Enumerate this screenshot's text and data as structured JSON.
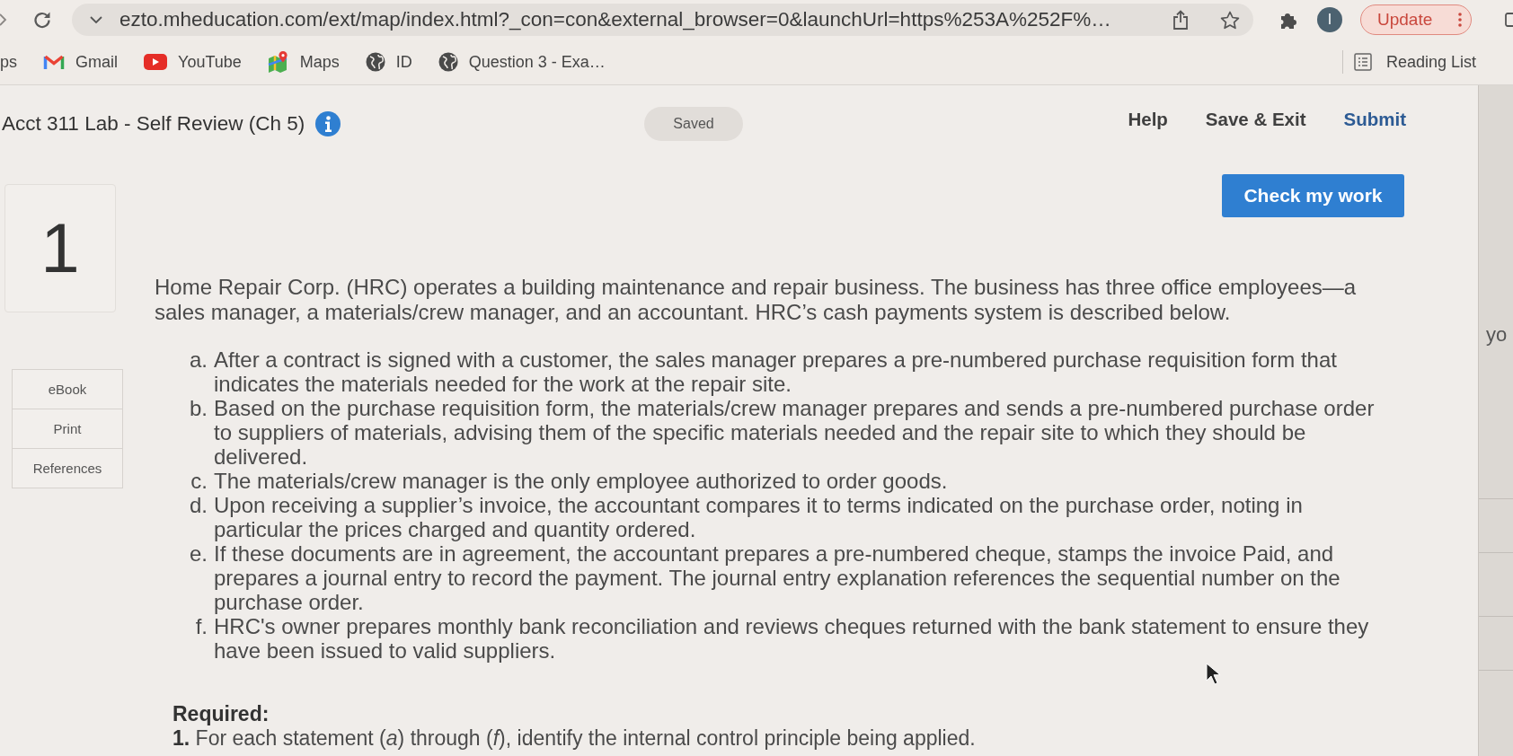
{
  "browser": {
    "address": "ezto.mheducation.com/ext/map/index.html?_con=con&external_browser=0&launchUrl=https%253A%252F%…",
    "profile_initial": "I",
    "update_button": "Update",
    "bookmarks": [
      {
        "label": "ps",
        "kind": "plain"
      },
      {
        "label": "Gmail",
        "kind": "mail"
      },
      {
        "label": "YouTube",
        "kind": "video"
      },
      {
        "label": "Maps",
        "kind": "map"
      },
      {
        "label": "ID",
        "kind": "globe"
      },
      {
        "label": "Question 3 - Exa…",
        "kind": "globe"
      }
    ],
    "reading_list": "Reading List"
  },
  "header": {
    "title": "Acct 311 Lab - Self Review (Ch 5)",
    "save_status": "Saved",
    "links": [
      {
        "label": "Help",
        "kind": "plain"
      },
      {
        "label": "Save & Exit",
        "kind": "plain"
      },
      {
        "label": "Submit",
        "kind": "accent"
      }
    ]
  },
  "check_button": "Check my work",
  "question": {
    "number": "1",
    "tools": [
      "eBook",
      "Print",
      "References"
    ],
    "intro": "Home Repair Corp. (HRC) operates a building maintenance and repair business. The business has three office employees—a sales manager, a materials/crew manager, and an accountant. HRC’s cash payments system is described below.",
    "statements": [
      {
        "letter": "a.",
        "text": "After a contract is signed with a customer, the sales manager prepares a pre-numbered purchase requisition form that indicates the materials needed for the work at the repair site."
      },
      {
        "letter": "b.",
        "text": "Based on the purchase requisition form, the materials/crew manager prepares and sends a pre-numbered purchase order to suppliers of materials, advising them of the specific materials needed and the repair site to which they should be delivered."
      },
      {
        "letter": "c.",
        "text": "The materials/crew manager is the only employee authorized to order goods."
      },
      {
        "letter": "d.",
        "text": "Upon receiving a supplier’s invoice, the accountant compares it to terms indicated on the purchase order, noting in particular the prices charged and quantity ordered."
      },
      {
        "letter": "e.",
        "text": "If these documents are in agreement, the accountant prepares a pre-numbered cheque, stamps the invoice Paid, and prepares a journal entry to record the payment. The journal entry explanation references the sequential number on the purchase order."
      },
      {
        "letter": "f.",
        "text": "HRC's owner prepares monthly bank reconciliation and reviews cheques returned with the bank statement to ensure they have been issued to valid suppliers."
      }
    ],
    "required_heading": "Required:",
    "requirements": [
      {
        "number": "1.",
        "text": "For each statement (*a*) through (*f*), identify the internal control principle being applied."
      }
    ]
  },
  "side_panel": {
    "text": "yo"
  }
}
